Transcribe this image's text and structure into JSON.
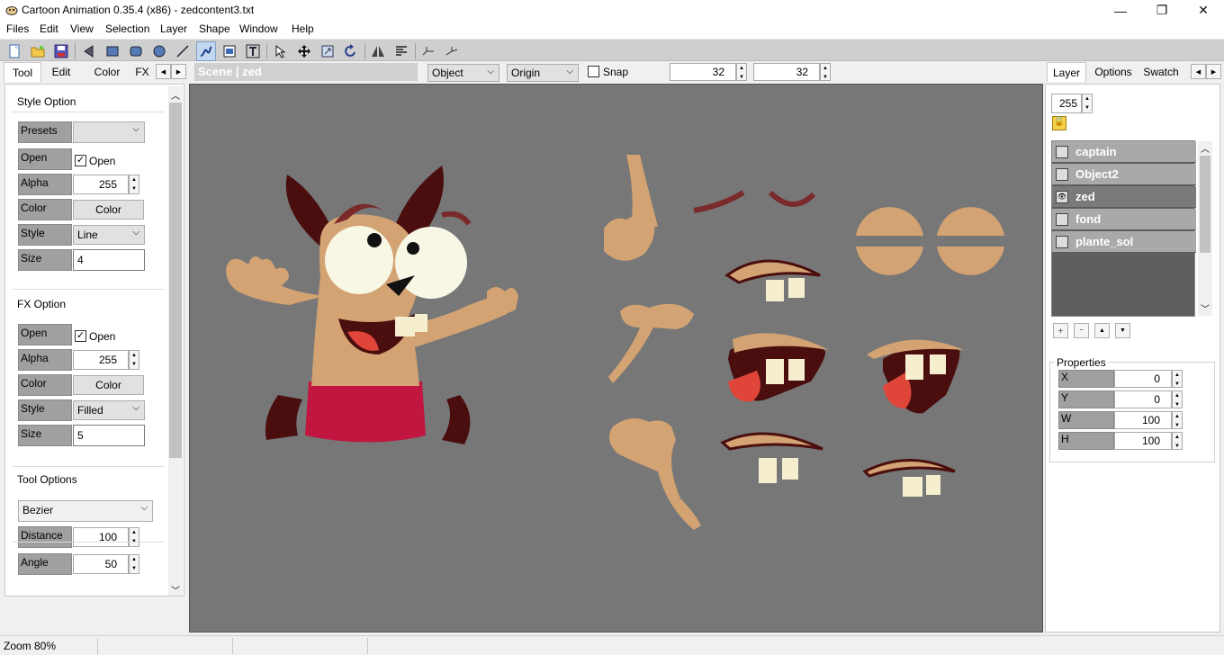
{
  "window": {
    "title": "Cartoon Animation 0.35.4 (x86) - zedcontent3.txt",
    "minimize": "—",
    "maximize": "❐",
    "close": "✕"
  },
  "menu": [
    "Files",
    "Edit",
    "View",
    "Selection",
    "Layer",
    "Shape",
    "Window",
    "Help"
  ],
  "toolbar": {
    "icons": [
      "new-file-icon",
      "open-folder-icon",
      "save-icon",
      "lasso-icon",
      "rectangle-icon",
      "rounded-rect-icon",
      "ellipse-icon",
      "line-icon",
      "bezier-icon",
      "image-icon",
      "text-icon",
      "node-edit-icon",
      "move-icon",
      "resize-icon",
      "rotate-icon",
      "flip-icon",
      "align-icon",
      "path-a-icon",
      "path-b-icon"
    ]
  },
  "left_tabs": [
    "Tool",
    "Edit",
    "Color",
    "FX"
  ],
  "scene_label": "Scene | zed",
  "topbar": {
    "mode_select": "Object",
    "origin_select": "Origin",
    "snap_label": "Snap",
    "grid_x": "32",
    "grid_y": "32"
  },
  "style_option": {
    "title": "Style Option",
    "presets_label": "Presets",
    "presets_value": "",
    "open_label": "Open",
    "open_checkbox_label": "Open",
    "alpha_label": "Alpha",
    "alpha_value": "255",
    "color_label": "Color",
    "color_button": "Color",
    "style_label": "Style",
    "style_value": "Line",
    "size_label": "Size",
    "size_value": "4"
  },
  "fx_option": {
    "title": "FX Option",
    "open_label": "Open",
    "open_checkbox_label": "Open",
    "alpha_label": "Alpha",
    "alpha_value": "255",
    "color_label": "Color",
    "color_button": "Color",
    "style_label": "Style",
    "style_value": "Filled",
    "size_label": "Size",
    "size_value": "5"
  },
  "tool_options": {
    "title": "Tool Options",
    "tool_value": "Bezier",
    "distance_label": "Distance",
    "distance_value": "100",
    "angle_label": "Angle",
    "angle_value": "50"
  },
  "right_tabs": [
    "Layer",
    "Options",
    "Swatch"
  ],
  "layer_panel": {
    "opacity_value": "255",
    "layers": [
      {
        "name": "captain",
        "visible": false
      },
      {
        "name": "Object2",
        "visible": false
      },
      {
        "name": "zed",
        "visible": true
      },
      {
        "name": "fond",
        "visible": false
      },
      {
        "name": "plante_sol",
        "visible": false
      }
    ]
  },
  "properties": {
    "title": "Properties",
    "x_label": "X",
    "x_value": "0",
    "y_label": "Y",
    "y_value": "0",
    "w_label": "W",
    "w_value": "100",
    "h_label": "H",
    "h_value": "100"
  },
  "status": {
    "zoom": "Zoom 80%"
  },
  "colors": {
    "canvas_bg": "#777777",
    "skin": "#d4a373",
    "dark_brown": "#4a0e0e",
    "pants": "#c0163f",
    "tongue": "#e0453a",
    "teeth": "#f5efd0",
    "eye_white": "#f8f6e4"
  }
}
